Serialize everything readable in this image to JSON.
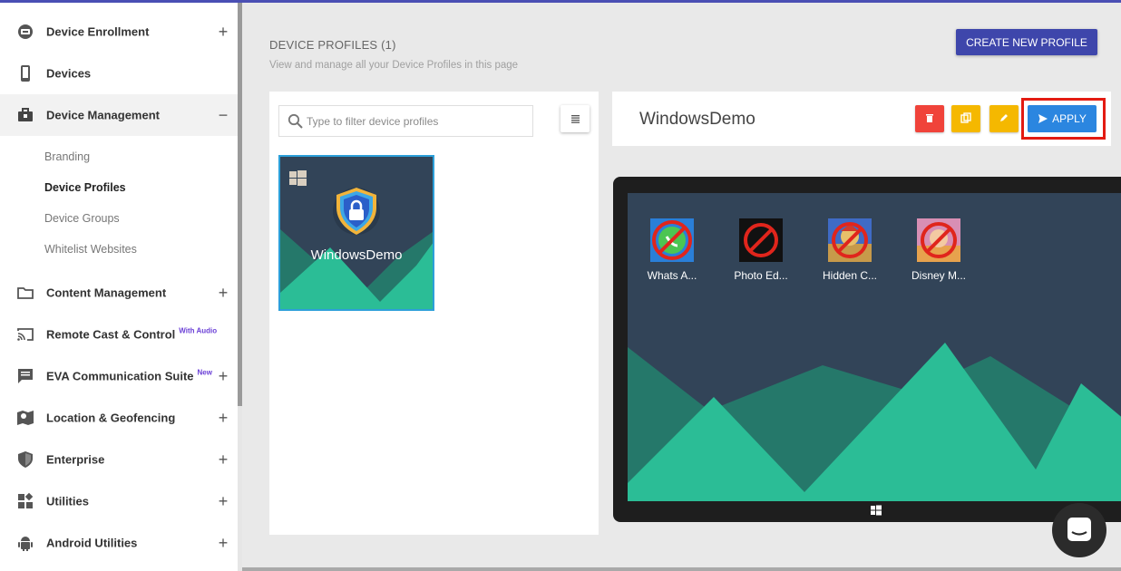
{
  "sidebar": {
    "items": [
      {
        "label": "Device Enrollment",
        "toggle": "+"
      },
      {
        "label": "Devices",
        "toggle": ""
      },
      {
        "label": "Device Management",
        "toggle": "−"
      },
      {
        "label": "Content Management",
        "toggle": "+"
      },
      {
        "label": "Remote Cast & Control",
        "badge": "With Audio",
        "toggle": ""
      },
      {
        "label": "EVA Communication Suite",
        "badge": "New",
        "toggle": "+"
      },
      {
        "label": "Location & Geofencing",
        "toggle": "+"
      },
      {
        "label": "Enterprise",
        "toggle": "+"
      },
      {
        "label": "Utilities",
        "toggle": "+"
      },
      {
        "label": "Android Utilities",
        "toggle": "+"
      }
    ],
    "subitems": [
      "Branding",
      "Device Profiles",
      "Device Groups",
      "Whitelist Websites"
    ]
  },
  "main": {
    "title": "DEVICE PROFILES (1)",
    "subtitle": "View and manage all your Device Profiles in this page",
    "create_label": "CREATE NEW PROFILE",
    "search_placeholder": "Type to filter device profiles",
    "profiles": [
      {
        "name": "WindowsDemo"
      }
    ]
  },
  "detail": {
    "name": "WindowsDemo",
    "apply_label": "APPLY",
    "apps": [
      "Whats A...",
      "Photo Ed...",
      "Hidden C...",
      "Disney M..."
    ]
  },
  "colors": {
    "accent": "#3e46ab",
    "apply": "#2b86e0",
    "delete": "#f0433a",
    "copy": "#f5b800",
    "edit": "#f5b800",
    "highlight": "#e31b12",
    "screen_bg": "#324458",
    "mountain_dark": "#25786a",
    "mountain_light": "#2bbd96"
  },
  "icons": {
    "delete": "trash-icon",
    "copy": "copy-icon",
    "edit": "pencil-icon",
    "apply": "send-icon",
    "search": "search-icon",
    "list": "list-icon"
  }
}
